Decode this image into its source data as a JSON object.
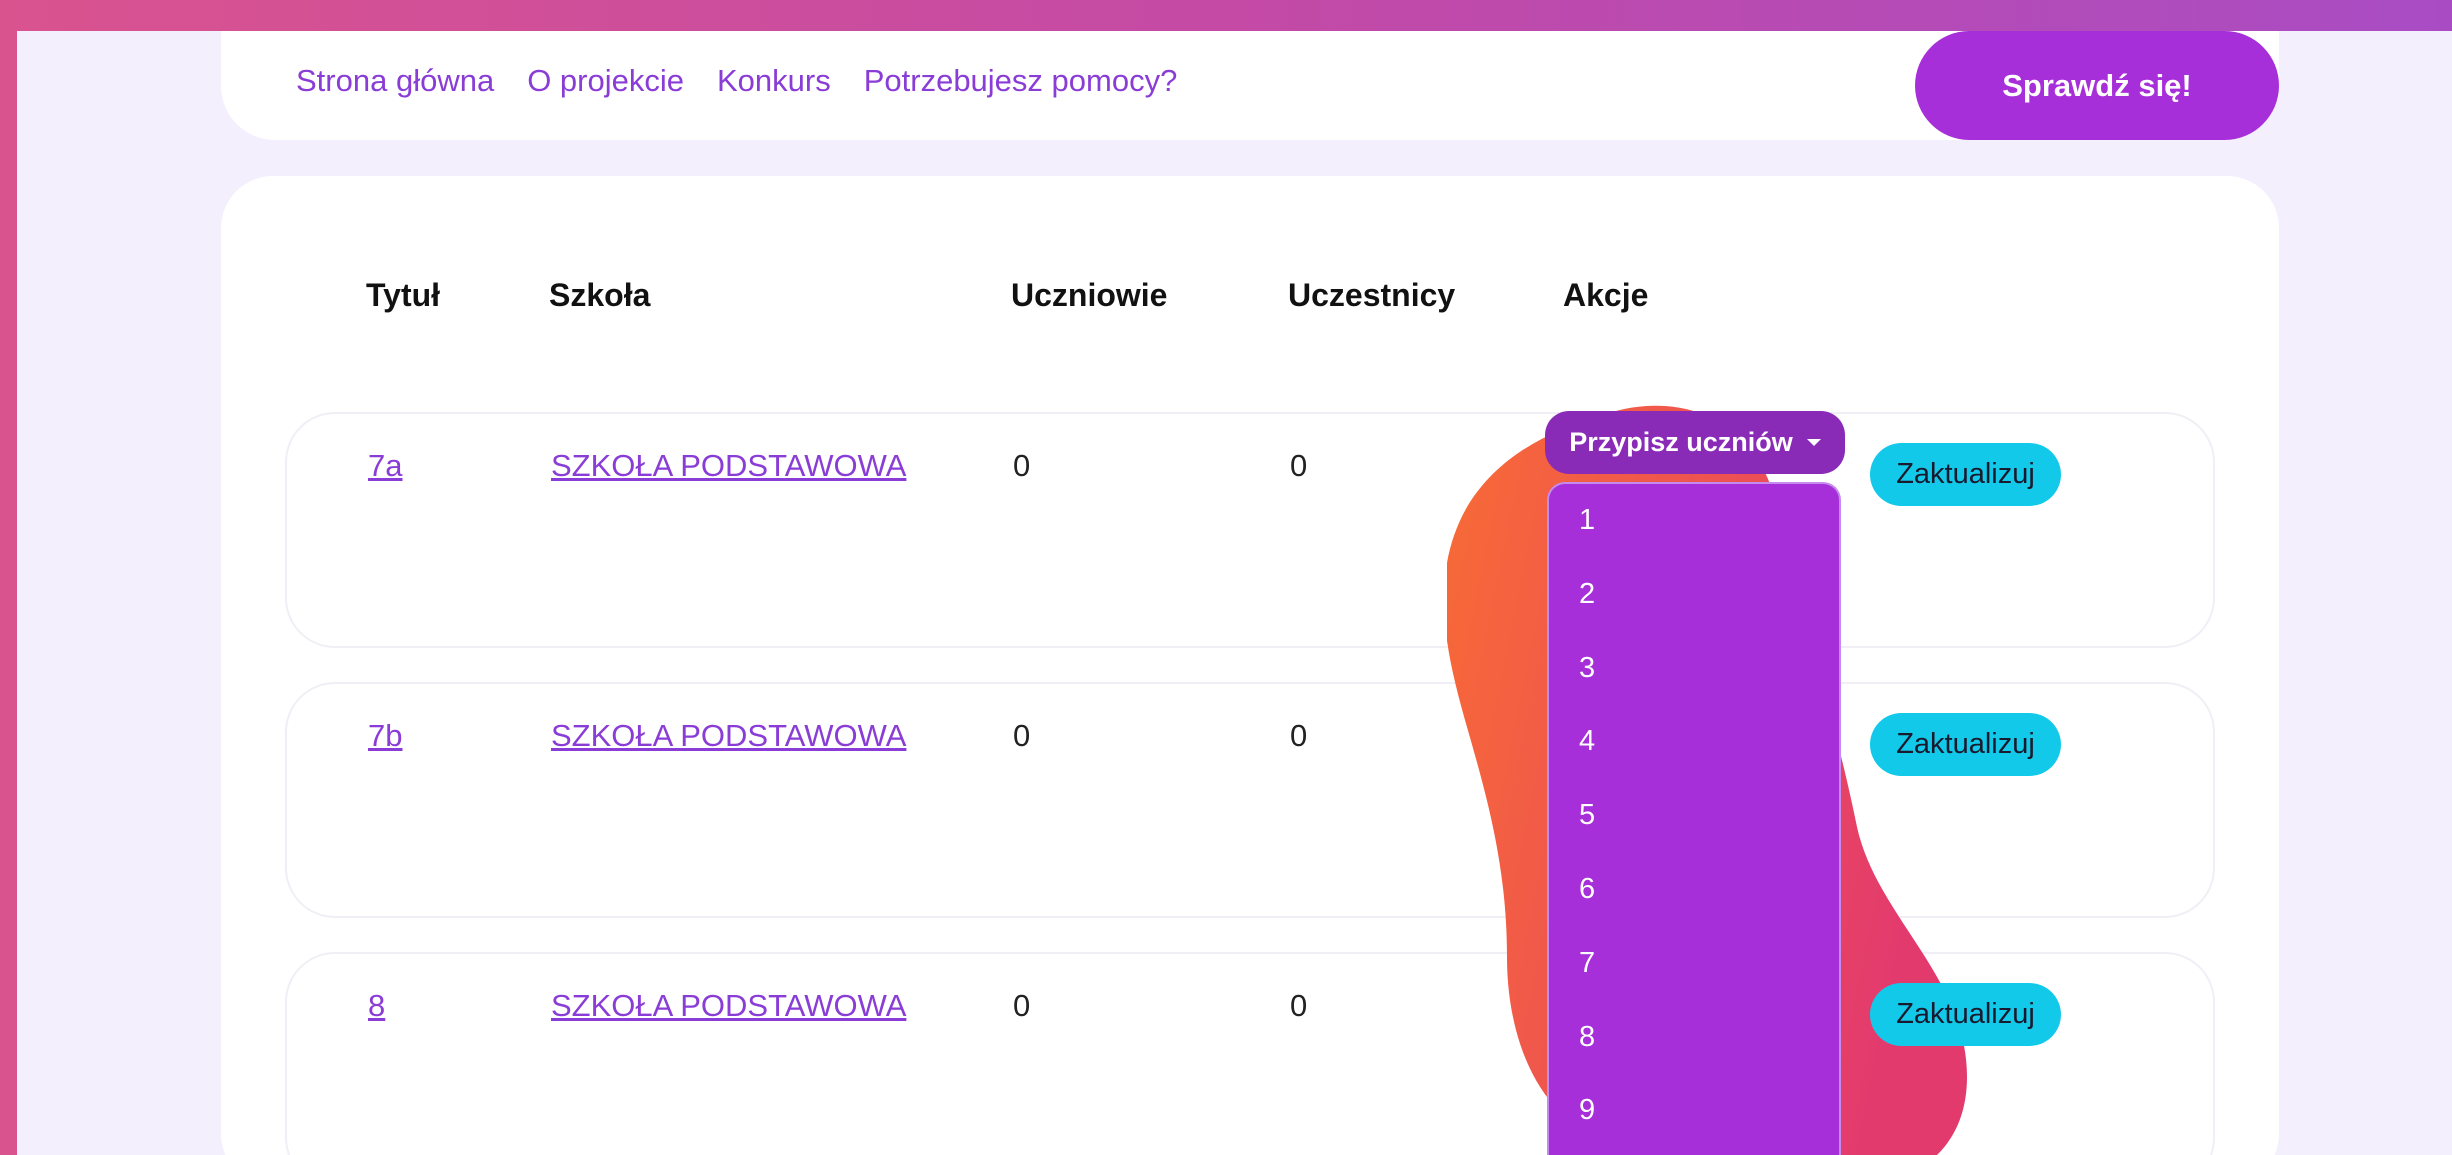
{
  "nav": {
    "links": [
      "Strona główna",
      "O projekcie",
      "Konkurs",
      "Potrzebujesz pomocy?"
    ],
    "cta_label": "Sprawdź się!"
  },
  "table": {
    "headers": [
      "Tytuł",
      "Szkoła",
      "Uczniowie",
      "Uczestnicy",
      "Akcje"
    ],
    "rows": [
      {
        "title": "7a",
        "school": "SZKOŁA PODSTAWOWA",
        "students": "0",
        "participants": "0",
        "update_label": "Zaktualizuj"
      },
      {
        "title": "7b",
        "school": "SZKOŁA PODSTAWOWA",
        "students": "0",
        "participants": "0",
        "update_label": "Zaktualizuj"
      },
      {
        "title": "8",
        "school": "SZKOŁA PODSTAWOWA",
        "students": "0",
        "participants": "0",
        "update_label": "Zaktualizuj"
      }
    ]
  },
  "assign_dropdown": {
    "label": "Przypisz uczniów",
    "options": [
      "1",
      "2",
      "3",
      "4",
      "5",
      "6",
      "7",
      "8",
      "9"
    ]
  },
  "colors": {
    "accent": "#a72fd9",
    "update_button": "#12c9ea",
    "blob_start": "#f86b35",
    "blob_end": "#e33a6e"
  }
}
